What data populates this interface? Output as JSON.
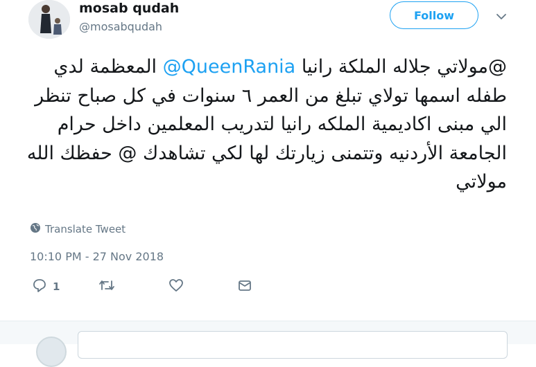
{
  "user": {
    "name": "mosab qudah",
    "handle": "@mosabqudah",
    "follow_label": "Follow"
  },
  "tweet": {
    "mention": "@QueenRania",
    "text_before_mention": "",
    "text_line1_rest": " @مولاتي جلاله الملكة رانيا",
    "text_body": "المعظمة لدي طفله اسمها تولاي تبلغ من العمر ٦ سنوات في كل صباح تنظر الي مبنى اكاديمية الملكه رانيا لتدريب المعلمين داخل حرام الجامعة الأردنيه وتتمنى زيارتك لها لكي تشاهدك @ حفظك الله مولاتي",
    "translate_label": "Translate Tweet",
    "timestamp": "10:10 PM - 27 Nov 2018"
  },
  "actions": {
    "reply_count": "1",
    "retweet_count": "",
    "like_count": ""
  },
  "colors": {
    "accent": "#1da1f2",
    "muted": "#657786",
    "text": "#14171a"
  },
  "icons": [
    "globe-icon",
    "reply-icon",
    "retweet-icon",
    "like-icon",
    "message-icon",
    "chevron-down-icon"
  ]
}
